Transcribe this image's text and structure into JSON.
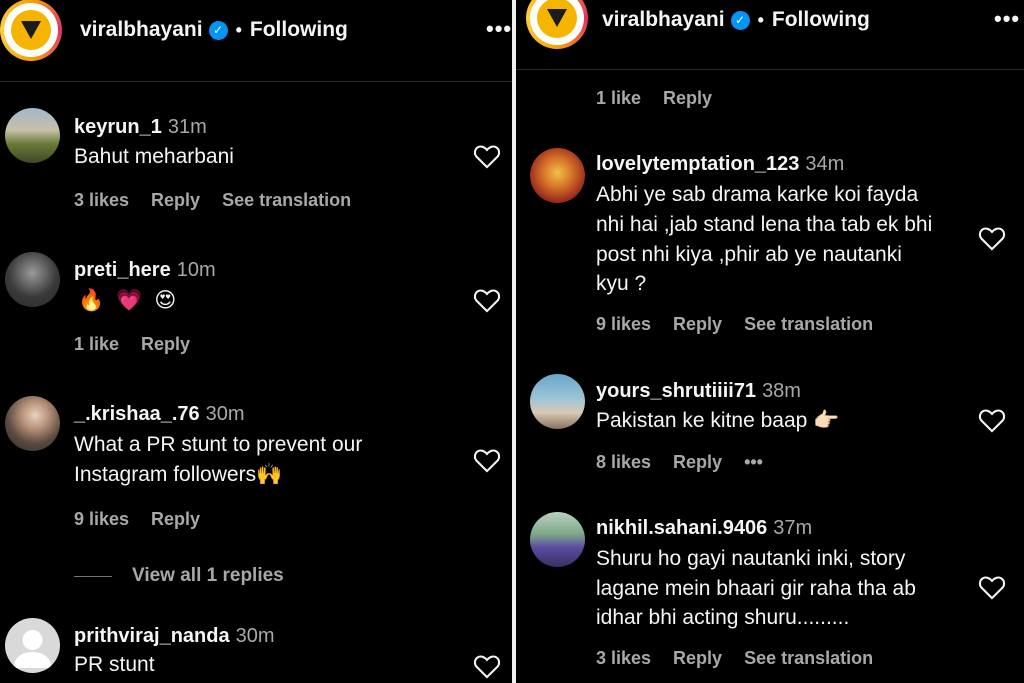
{
  "header": {
    "username": "viralbhayani",
    "follow_status": "Following",
    "separator": "•",
    "more_glyph": "•••",
    "verified_glyph": "✓"
  },
  "colors": {
    "accent": "#0095f6",
    "background": "#000000",
    "muted": "#a8a8a8",
    "logo": "#f4b400"
  },
  "left_panel": {
    "comments": [
      {
        "username": "keyrun_1",
        "time": "31m",
        "text": "Bahut meharbani",
        "likes": "3 likes",
        "reply": "Reply",
        "translation": "See translation"
      },
      {
        "username": "preti_here",
        "time": "10m",
        "text_emojis": [
          "🔥",
          "💗",
          "😍"
        ],
        "likes": "1 like",
        "reply": "Reply"
      },
      {
        "username": "_.krishaa_.76",
        "time": "30m",
        "text_lines": [
          "What a PR stunt to prevent our",
          "Instagram followers🙌"
        ],
        "likes": "9 likes",
        "reply": "Reply",
        "view_replies": "View all 1 replies"
      },
      {
        "username": "prithviraj_nanda",
        "time": "30m",
        "text": "PR stunt"
      }
    ]
  },
  "right_panel": {
    "top_meta": {
      "likes": "1 like",
      "reply": "Reply"
    },
    "comments": [
      {
        "username": "lovelytemptation_123",
        "time": "34m",
        "text_lines": [
          "Abhi ye sab drama karke koi fayda",
          "nhi hai ,jab stand lena tha tab ek bhi",
          "post nhi kiya ,phir ab ye nautanki",
          "kyu ?"
        ],
        "likes": "9 likes",
        "reply": "Reply",
        "translation": "See translation"
      },
      {
        "username": "yours_shrutiiii71",
        "time": "38m",
        "text": "Pakistan ke kitne baap 👉🏻",
        "likes": "8 likes",
        "reply": "Reply",
        "more": "•••"
      },
      {
        "username": "nikhil.sahani.9406",
        "time": "37m",
        "text_lines": [
          "Shuru ho gayi nautanki inki, story",
          "lagane mein bhaari gir raha tha ab",
          "idhar bhi acting shuru........."
        ],
        "likes": "3 likes",
        "reply": "Reply",
        "translation": "See translation"
      }
    ]
  }
}
